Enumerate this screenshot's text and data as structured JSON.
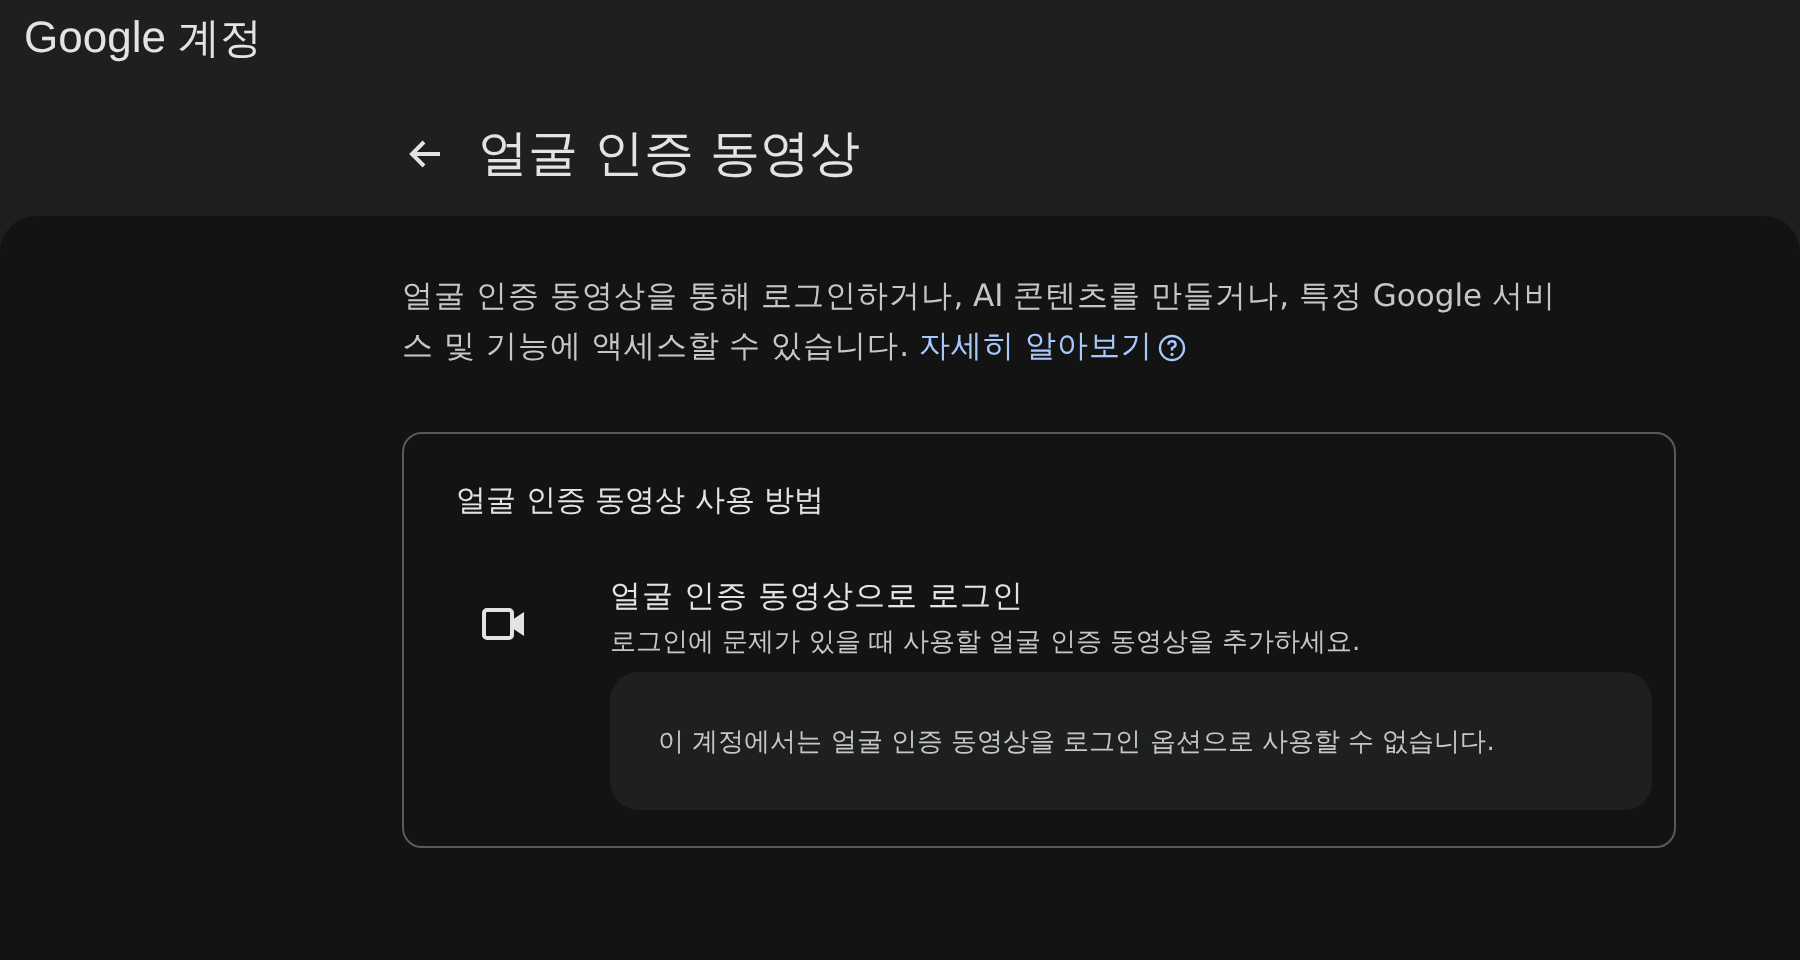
{
  "header": {
    "brand": "Google",
    "product": "계정"
  },
  "page": {
    "title": "얼굴 인증 동영상"
  },
  "intro": {
    "text": "얼굴 인증 동영상을 통해 로그인하거나, AI 콘텐츠를 만들거나, 특정 Google 서비스 및 기능에 액세스할 수 있습니다.",
    "link": "자세히 알아보기"
  },
  "card": {
    "title": "얼굴 인증 동영상 사용 방법",
    "items": [
      {
        "kind": "video",
        "title": "얼굴 인증 동영상으로 로그인",
        "subtitle": "로그인에 문제가 있을 때 사용할 얼굴 인증 동영상을 추가하세요.",
        "notice": "이 계정에서는 얼굴 인증 동영상을 로그인 옵션으로 사용할 수 없습니다."
      }
    ]
  }
}
